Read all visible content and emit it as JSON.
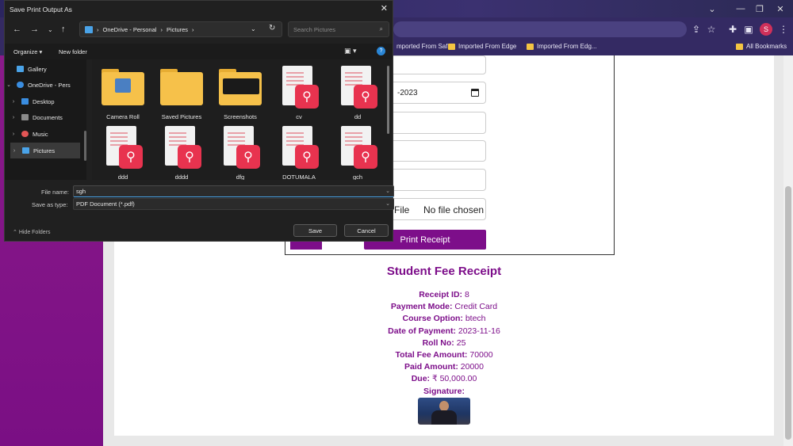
{
  "browser": {
    "window_controls": [
      "⌄",
      "—",
      "❐",
      "✕"
    ],
    "bookmarks": [
      "mported From Saf...",
      "Imported From Edge",
      "Imported From Edg...",
      "All Bookmarks"
    ],
    "profile_initial": "S",
    "toolbar_icons": [
      "share-icon",
      "star-icon",
      "extensions-icon",
      "sidepanel-icon",
      "profile-avatar",
      "menu-icon"
    ]
  },
  "page": {
    "date_value": "-2023",
    "file_button": "se File",
    "file_status": "No file chosen",
    "print_button": "Print Receipt",
    "receipt_title": "Student Fee Receipt",
    "receipt": [
      {
        "label": "Receipt ID:",
        "value": "8"
      },
      {
        "label": "Payment Mode:",
        "value": "Credit Card"
      },
      {
        "label": "Course Option:",
        "value": "btech"
      },
      {
        "label": "Date of Payment:",
        "value": "2023-11-16"
      },
      {
        "label": "Roll No:",
        "value": "25"
      },
      {
        "label": "Total Fee Amount:",
        "value": "70000"
      },
      {
        "label": "Paid Amount:",
        "value": "20000"
      },
      {
        "label": "Due:",
        "value": "₹ 50,000.00"
      },
      {
        "label": "Signature:",
        "value": ""
      }
    ]
  },
  "dialog": {
    "title": "Save Print Output As",
    "breadcrumb": [
      "OneDrive - Personal",
      "Pictures"
    ],
    "search_placeholder": "Search Pictures",
    "organize": "Organize",
    "new_folder": "New folder",
    "nav_items": [
      {
        "label": "Gallery",
        "color": "#4aa3e8"
      },
      {
        "label": "OneDrive - Pers",
        "color": "#3a8de0"
      },
      {
        "label": "Desktop",
        "color": "#3a8de0"
      },
      {
        "label": "Documents",
        "color": "#8a8a8a"
      },
      {
        "label": "Music",
        "color": "#e25555"
      },
      {
        "label": "Pictures",
        "color": "#4aa3e8"
      }
    ],
    "files": [
      {
        "name": "Camera Roll",
        "kind": "folder"
      },
      {
        "name": "Saved Pictures",
        "kind": "folder"
      },
      {
        "name": "Screenshots",
        "kind": "folder"
      },
      {
        "name": "cv",
        "kind": "pdf"
      },
      {
        "name": "dd",
        "kind": "pdf"
      },
      {
        "name": "ddd",
        "kind": "pdf"
      },
      {
        "name": "dddd",
        "kind": "pdf"
      },
      {
        "name": "dfg",
        "kind": "pdf"
      },
      {
        "name": "DOTUMALA",
        "kind": "pdf"
      },
      {
        "name": "gch",
        "kind": "pdf"
      }
    ],
    "file_name_label": "File name:",
    "file_name_value": "sgh",
    "save_type_label": "Save as type:",
    "save_type_value": "PDF Document (*.pdf)",
    "hide_folders": "Hide Folders",
    "save": "Save",
    "cancel": "Cancel"
  }
}
